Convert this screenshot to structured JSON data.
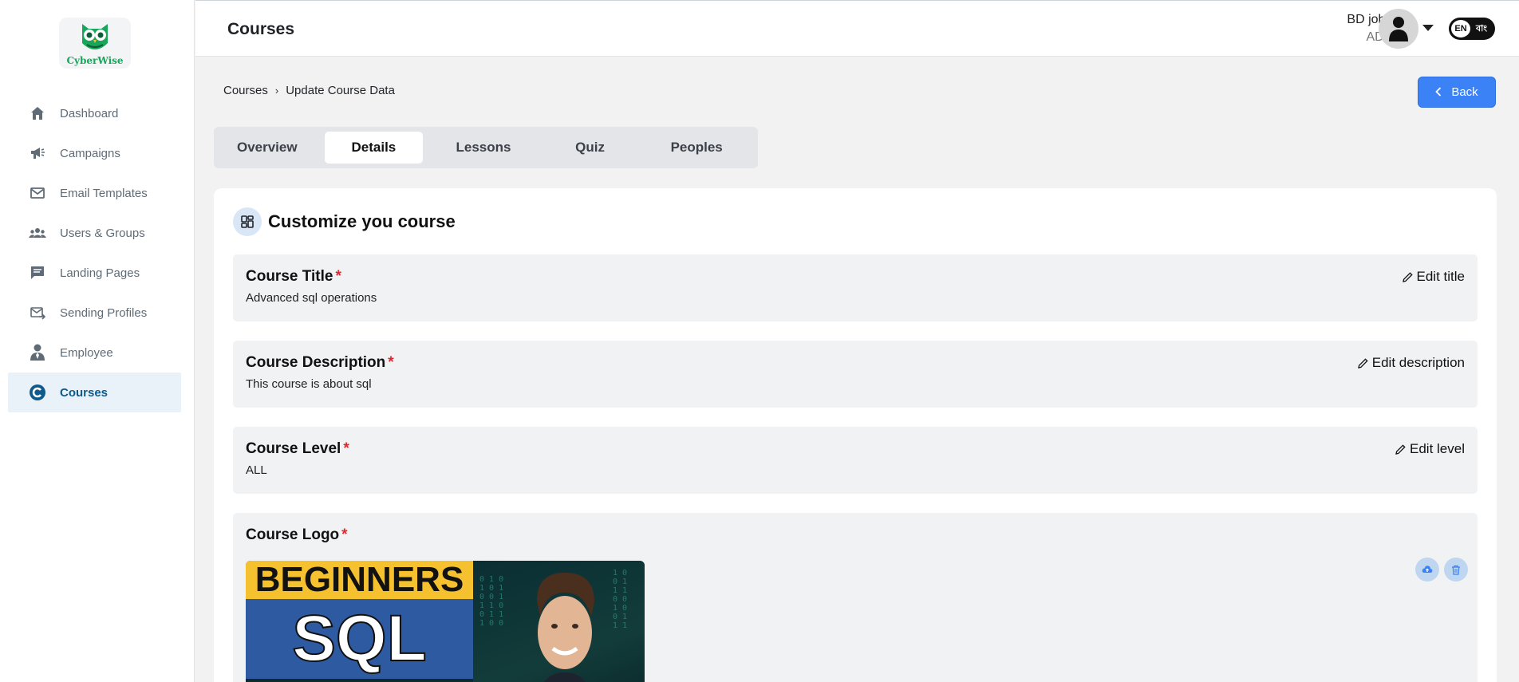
{
  "app": {
    "logo_text": "CyberWise"
  },
  "sidebar": {
    "items": [
      {
        "label": "Dashboard",
        "icon": "home-icon"
      },
      {
        "label": "Campaigns",
        "icon": "megaphone-icon"
      },
      {
        "label": "Email Templates",
        "icon": "mail-icon"
      },
      {
        "label": "Users & Groups",
        "icon": "users-icon"
      },
      {
        "label": "Landing Pages",
        "icon": "chat-icon"
      },
      {
        "label": "Sending Profiles",
        "icon": "mail-send-icon"
      },
      {
        "label": "Employee",
        "icon": "employee-icon"
      },
      {
        "label": "Courses",
        "icon": "courses-icon",
        "active": true
      }
    ]
  },
  "header": {
    "title": "Courses",
    "user_name": "BD job HR",
    "user_role": "ADMIN",
    "lang_en": "EN",
    "lang_bn": "বাং"
  },
  "breadcrumb": {
    "parent": "Courses",
    "current": "Update Course Data"
  },
  "back_label": "Back",
  "tabs": [
    "Overview",
    "Details",
    "Lessons",
    "Quiz",
    "Peoples"
  ],
  "active_tab": "Details",
  "card": {
    "title": "Customize you course",
    "fields": {
      "title": {
        "label": "Course Title",
        "value": "Advanced sql operations",
        "edit": "Edit title"
      },
      "description": {
        "label": "Course Description",
        "value": "This course is about sql",
        "edit": "Edit description"
      },
      "level": {
        "label": "Course Level",
        "value": "ALL",
        "edit": "Edit level"
      },
      "logo": {
        "label": "Course Logo",
        "image_text_top": "BEGINNERS",
        "image_text_main": "SQL"
      }
    },
    "required_mark": "*"
  },
  "colors": {
    "accent": "#3b82f6",
    "active_nav_bg": "#e9f1f9",
    "active_nav_text": "#0e5a8a",
    "required": "#e5262b",
    "brand_green": "#17a65a"
  }
}
